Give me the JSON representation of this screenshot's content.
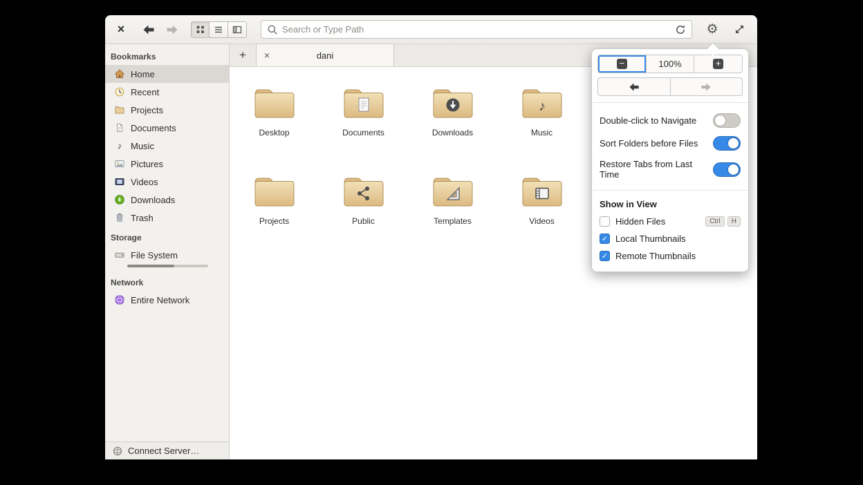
{
  "icons": {
    "close": "×",
    "tab_close": "×",
    "new_tab": "+",
    "gear": "⚙",
    "check": "✓",
    "music_note": "♪",
    "zoom_out": "−",
    "zoom_in": "+"
  },
  "header": {
    "search_placeholder": "Search or Type Path"
  },
  "sidebar": {
    "sections": [
      {
        "title": "Bookmarks",
        "items": [
          {
            "label": "Home"
          },
          {
            "label": "Recent"
          },
          {
            "label": "Projects"
          },
          {
            "label": "Documents"
          },
          {
            "label": "Music"
          },
          {
            "label": "Pictures"
          },
          {
            "label": "Videos"
          },
          {
            "label": "Downloads"
          },
          {
            "label": "Trash"
          }
        ]
      },
      {
        "title": "Storage",
        "items": [
          {
            "label": "File System"
          }
        ]
      },
      {
        "title": "Network",
        "items": [
          {
            "label": "Entire Network"
          }
        ]
      }
    ],
    "connect_server": "Connect Server…"
  },
  "tabbar": {
    "active_tab": "dani"
  },
  "files": [
    {
      "name": "Desktop"
    },
    {
      "name": "Documents"
    },
    {
      "name": "Downloads"
    },
    {
      "name": "Music"
    },
    {
      "name": "Projects"
    },
    {
      "name": "Public"
    },
    {
      "name": "Templates"
    },
    {
      "name": "Videos"
    }
  ],
  "popover": {
    "zoom_level": "100%",
    "toggles": [
      {
        "label": "Double-click to Navigate",
        "on": false
      },
      {
        "label": "Sort Folders before Files",
        "on": true
      },
      {
        "label": "Restore Tabs from Last Time",
        "on": true
      }
    ],
    "show_in_view": {
      "title": "Show in View",
      "items": [
        {
          "label": "Hidden Files",
          "checked": false,
          "shortcut": [
            "Ctrl",
            "H"
          ]
        },
        {
          "label": "Local Thumbnails",
          "checked": true
        },
        {
          "label": "Remote Thumbnails",
          "checked": true
        }
      ]
    }
  },
  "colors": {
    "accent": "#3689e6",
    "folder": "#e4c58f",
    "toggle_off": "#cfccc8"
  }
}
